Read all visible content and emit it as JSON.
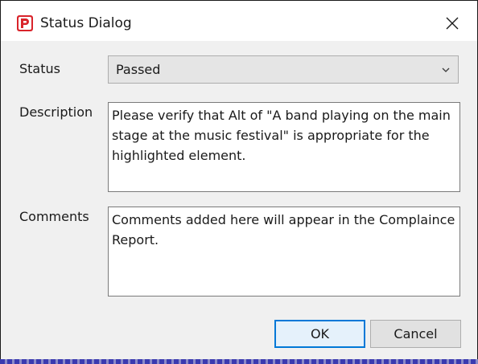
{
  "window": {
    "title": "Status Dialog",
    "icon": "app-logo-icon",
    "close_icon": "close-icon"
  },
  "form": {
    "status": {
      "label": "Status",
      "value": "Passed"
    },
    "description": {
      "label": "Description",
      "value": "Please verify that Alt of \"A band playing on the main stage at the music festival\" is appropriate for the highlighted element."
    },
    "comments": {
      "label": "Comments",
      "value": "Comments added here will appear in the Complaince Report."
    }
  },
  "buttons": {
    "ok_label": "OK",
    "cancel_label": "Cancel"
  },
  "colors": {
    "accent": "#0078d7",
    "logo": "#d9242b"
  }
}
